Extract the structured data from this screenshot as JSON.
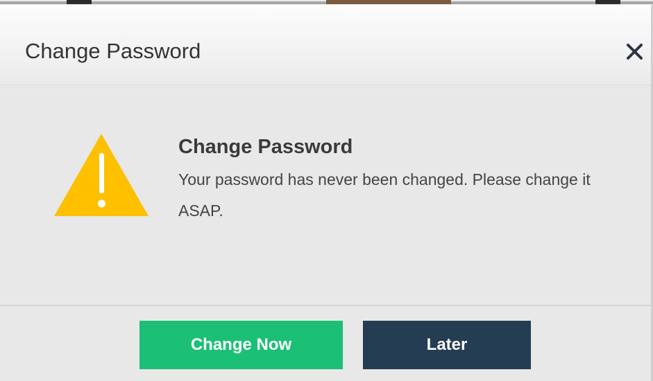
{
  "dialog": {
    "title": "Change Password",
    "close_icon": "close-icon",
    "message": {
      "icon": "warning-icon",
      "icon_color": "#FFC000",
      "title": "Change Password",
      "body": "Your password has never been changed. Please change it ASAP."
    },
    "buttons": {
      "primary_label": "Change Now",
      "primary_color": "#1BC076",
      "secondary_label": "Later",
      "secondary_color": "#243D52"
    }
  }
}
